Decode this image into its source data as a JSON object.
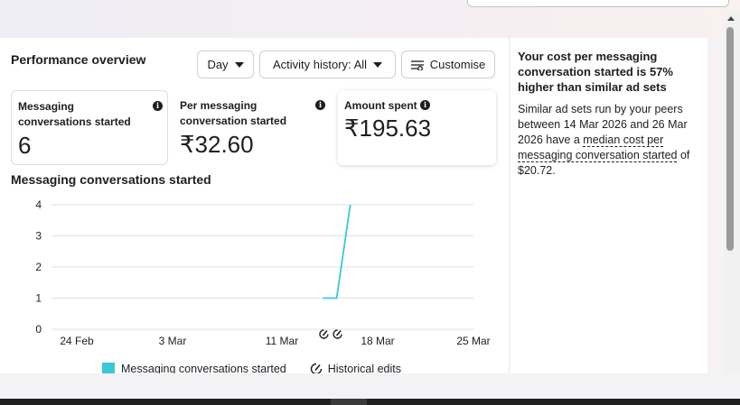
{
  "header": {
    "section_title": "Performance overview",
    "day_button": "Day",
    "activity_button": "Activity history: All",
    "customise_button": "Customise"
  },
  "metrics": [
    {
      "label": "Messaging conversations started",
      "value": "6"
    },
    {
      "label": "Per messaging conversation started",
      "value": "₹32.60"
    },
    {
      "label": "Amount spent",
      "value": "₹195.63"
    }
  ],
  "chart_title": "Messaging conversations started",
  "chart_data": {
    "type": "line",
    "x_ticks": [
      "24 Feb",
      "3 Mar",
      "11 Mar",
      "18 Mar",
      "25 Mar"
    ],
    "y_ticks": [
      "0",
      "1",
      "2",
      "3",
      "4"
    ],
    "ylim": [
      0,
      4
    ],
    "series": [
      {
        "name": "Messaging conversations started",
        "color": "#3ec6d6",
        "points": [
          {
            "x": "14 Mar",
            "y": 1
          },
          {
            "x": "15 Mar",
            "y": 1
          },
          {
            "x": "16 Mar",
            "y": 4
          }
        ]
      }
    ],
    "legend": [
      "Messaging conversations started",
      "Historical edits"
    ],
    "grid": true
  },
  "insight": {
    "title": "Your cost per messaging conversation started is 57% higher than similar ad sets",
    "body_prefix": "Similar ad sets run by your peers between 14 Mar 2026 and 26 Mar 2026 have a",
    "body_link": "median cost per messaging conversation started",
    "body_suffix": "of $20.72."
  },
  "icons": {
    "caret": "caret-down-icon",
    "customise": "sliders-icon",
    "info": "info-icon",
    "edit": "historical-edit-icon"
  }
}
